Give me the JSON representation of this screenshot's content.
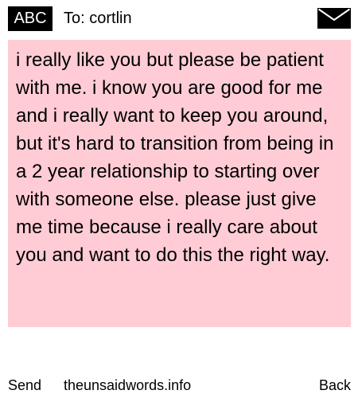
{
  "header": {
    "input_mode": "ABC",
    "recipient": "To: cortlin",
    "icon": "mail-envelope-icon"
  },
  "message": {
    "body": "i really like you but please be patient with me. i know you are good for me and i really want to keep you around, but it's hard to transition from being in a 2 year relationship to starting over with someone else. please just give me time because i really care about you and want to do this the right way."
  },
  "footer": {
    "send_label": "Send",
    "site_label": "theunsaidwords.info",
    "back_label": "Back"
  },
  "colors": {
    "message_background": "#ffccd5",
    "badge_background": "#000000",
    "badge_text": "#ffffff"
  }
}
